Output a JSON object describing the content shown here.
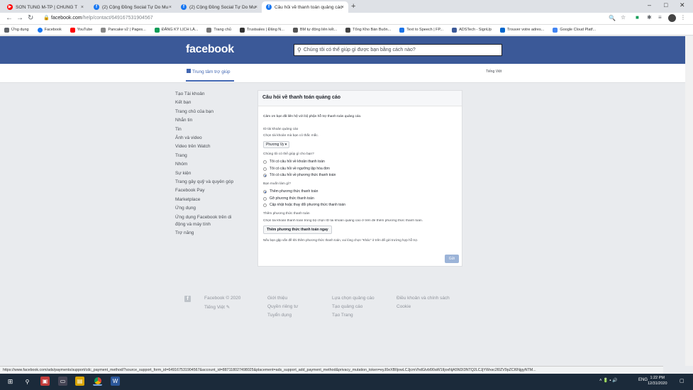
{
  "browser": {
    "tabs": [
      {
        "title": "SƠN TÙNG M-TP | CHÚNG T",
        "icon": "youtube-icon",
        "color": "#ff0000"
      },
      {
        "title": "(2) Cộng Đồng Social Tự Do Mu",
        "icon": "facebook-icon",
        "color": "#1877f2"
      },
      {
        "title": "(2) Cộng Đồng Social Tự Do Mu",
        "icon": "facebook-icon",
        "color": "#1877f2"
      },
      {
        "title": "Câu hỏi về thanh toán quảng cáo",
        "icon": "facebook-icon",
        "color": "#1877f2"
      }
    ],
    "url_host": "facebook.com",
    "url_path": "/help/contact/649167531904567",
    "bookmarks": [
      {
        "label": "Ứng dụng",
        "color": "#5f6368"
      },
      {
        "label": "Facebook",
        "color": "#1877f2"
      },
      {
        "label": "YouTube",
        "color": "#ff0000"
      },
      {
        "label": "Pancake v2 | Pages...",
        "color": "#888888"
      },
      {
        "label": "ĐĂNG KÝ LỊCH LÀ...",
        "color": "#0f9d58"
      },
      {
        "label": "Trang chủ",
        "color": "#777777"
      },
      {
        "label": "Trustsales | Đăng N...",
        "color": "#333333"
      },
      {
        "label": "BM tự động liên kết...",
        "color": "#555555"
      },
      {
        "label": "Tổng Kho Bán Buôn...",
        "color": "#444444"
      },
      {
        "label": "Text to Speech | FP...",
        "color": "#1a73e8"
      },
      {
        "label": "ADSTech - SignUp",
        "color": "#3b5998"
      },
      {
        "label": "Trouver votre adres...",
        "color": "#0066cc"
      },
      {
        "label": "Google Cloud Platf...",
        "color": "#4285f4"
      }
    ],
    "status_url": "https://www.facebook.com/ads/payments/support/cdc_payment_method/?source_support_form_id=649167531904567&account_id=887118027498025&placement=ads_support_add_payment_method&privacy_mutation_token=eyJ0eXBlIjowLCJjcmVhdGlvbl90aW1lIjoxNjA5NDI3NTQ2LCJjYWxsc2l0ZV9pZCI6NjgyNTM..."
  },
  "page": {
    "logo": "facebook",
    "search_placeholder": "Chúng tôi có thể giúp gì được bạn bằng cách nào?",
    "help_center": "Trung tâm trợ giúp",
    "language": "Tiếng Việt",
    "left_nav": [
      "Tạo Tài khoản",
      "Kết bạn",
      "Trang chủ của bạn",
      "Nhắn tin",
      "Tin",
      "Ảnh và video",
      "Video trên Watch",
      "Trang",
      "Nhóm",
      "Sự kiện",
      "Trang gây quỹ và quyên góp",
      "Facebook Pay",
      "Marketplace",
      "Ứng dụng",
      "Ứng dụng Facebook trên di động và máy tính",
      "Trợ năng"
    ],
    "card": {
      "title": "Câu hỏi về thanh toán quảng cáo",
      "intro": "Cảm ơn bạn đã liên hệ với bộ phận hỗ trợ thanh toán quảng cáo.",
      "account_label": "ID tài khoản quảng cáo",
      "account_help": "Chọn tài khoản mà bạn có thắc mắc.",
      "account_value": "Phương Vy",
      "q1": "Chúng tôi có thể giúp gì cho bạn?",
      "q1_options": [
        "Tôi có câu hỏi về khoản thanh toán",
        "Tôi có câu hỏi về ngưỡng lập hóa đơn",
        "Tôi có câu hỏi về phương thức thanh toán"
      ],
      "q2": "Bạn muốn làm gì?",
      "q2_options": [
        "Thêm phương thức thanh toán",
        "Gỡ phương thức thanh toán",
        "Cập nhật hoặc thay đổi phương thức thanh toán"
      ],
      "add_label": "Thêm phương thức thanh toán",
      "add_help": "Chọn tài khoản thanh toán trong bộ chọn ID tài khoản quảng cáo ở trên để thêm phương thức thanh toán.",
      "add_button": "Thêm phương thức thanh toán ngay",
      "footnote": "Nếu bạn gặp vấn đề khi thêm phương thức thanh toán, vui lòng chọn \"Khác\" ở trên để gửi trường hợp hỗ trợ.",
      "send": "Gửi"
    },
    "footer": {
      "copyright": "Facebook © 2020",
      "lang": "Tiếng Việt",
      "col1": [
        "Giới thiệu",
        "Quyền riêng tư",
        "Tuyển dụng"
      ],
      "col2": [
        "Lựa chọn quảng cáo",
        "Tạo quảng cáo",
        "Tạo Trang"
      ],
      "col3": [
        "Điều khoản và chính sách",
        "Cookie"
      ]
    }
  },
  "taskbar": {
    "clock_time": "1:22 PM",
    "clock_date": "12/31/2020",
    "lang": "ENG"
  }
}
